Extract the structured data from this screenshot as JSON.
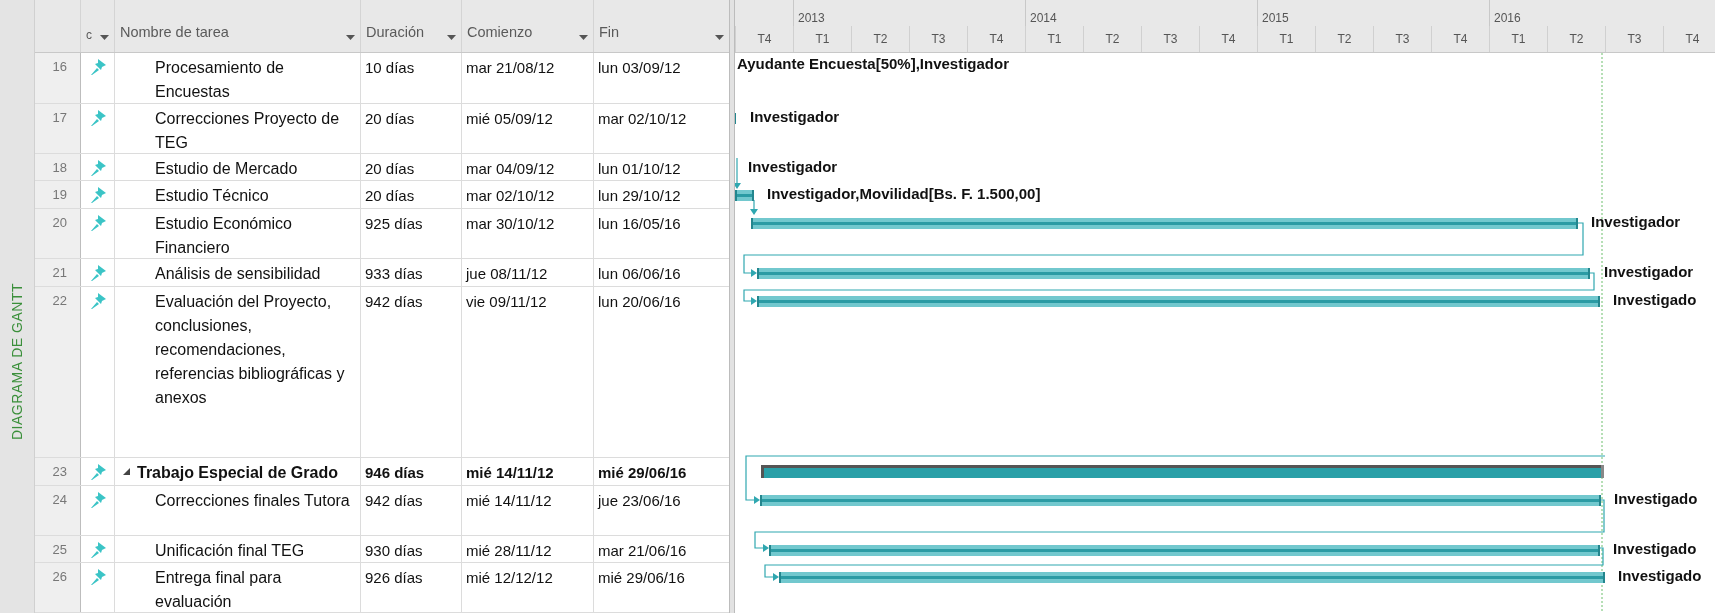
{
  "view_label": "DIAGRAMA DE GANTT",
  "columns": [
    {
      "label": "c",
      "kind": "indicator"
    },
    {
      "label": "Nombre de tarea",
      "kind": "name"
    },
    {
      "label": "Duración",
      "kind": "duration"
    },
    {
      "label": "Comienzo",
      "kind": "start"
    },
    {
      "label": "Fin",
      "kind": "finish"
    }
  ],
  "timescale": {
    "years": [
      {
        "label": "2013"
      },
      {
        "label": "2014"
      },
      {
        "label": "2015"
      },
      {
        "label": "2016"
      }
    ],
    "quarters": [
      {
        "label": "T4"
      },
      {
        "label": "T1"
      },
      {
        "label": "T2"
      },
      {
        "label": "T3"
      },
      {
        "label": "T4"
      },
      {
        "label": "T1"
      },
      {
        "label": "T2"
      },
      {
        "label": "T3"
      },
      {
        "label": "T4"
      },
      {
        "label": "T1"
      },
      {
        "label": "T2"
      },
      {
        "label": "T3"
      },
      {
        "label": "T4"
      },
      {
        "label": "T1"
      },
      {
        "label": "T2"
      },
      {
        "label": "T3"
      },
      {
        "label": "T4"
      }
    ]
  },
  "tasks": [
    {
      "id": "16",
      "kind": "task",
      "pinned": true,
      "name": "Procesamiento de Encuestas",
      "duration": "10 días",
      "start": "mar 21/08/12",
      "finish": "lun 03/09/12",
      "bar_label": "Ayudante Encuesta[50%],Investigador"
    },
    {
      "id": "17",
      "kind": "task",
      "pinned": true,
      "name": "Correcciones Proyecto de TEG",
      "duration": "20 días",
      "start": "mié 05/09/12",
      "finish": "mar 02/10/12",
      "bar_label": "Investigador"
    },
    {
      "id": "18",
      "kind": "task",
      "pinned": true,
      "name": "Estudio de Mercado",
      "duration": "20 días",
      "start": "mar 04/09/12",
      "finish": "lun 01/10/12",
      "bar_label": "Investigador"
    },
    {
      "id": "19",
      "kind": "task",
      "pinned": true,
      "name": "Estudio Técnico",
      "duration": "20 días",
      "start": "mar 02/10/12",
      "finish": "lun 29/10/12",
      "bar_label": "Investigador,Movilidad[Bs. F. 1.500,00]"
    },
    {
      "id": "20",
      "kind": "task",
      "pinned": true,
      "name": "Estudio Económico Financiero",
      "duration": "925 días",
      "start": "mar 30/10/12",
      "finish": "lun 16/05/16",
      "bar_label": "Investigador"
    },
    {
      "id": "21",
      "kind": "task",
      "pinned": true,
      "name": "Análisis de sensibilidad",
      "duration": "933 días",
      "start": "jue 08/11/12",
      "finish": "lun 06/06/16",
      "bar_label": "Investigador"
    },
    {
      "id": "22",
      "kind": "task",
      "pinned": true,
      "name": "Evaluación del Proyecto, conclusiones, recomendaciones, referencias bibliográficas y anexos",
      "duration": "942 días",
      "start": "vie 09/11/12",
      "finish": "lun 20/06/16",
      "bar_label": "Investigado"
    },
    {
      "id": "23",
      "kind": "summary",
      "pinned": true,
      "expanded": true,
      "name": "Trabajo Especial de Grado",
      "duration": "946 días",
      "start": "mié 14/11/12",
      "finish": "mié 29/06/16",
      "children": [
        {
          "id": "24",
          "kind": "task",
          "pinned": true,
          "name": "Correcciones finales Tutora",
          "duration": "942 días",
          "start": "mié 14/11/12",
          "finish": "jue 23/06/16",
          "bar_label": "Investigado"
        },
        {
          "id": "25",
          "kind": "task",
          "pinned": true,
          "name": "Unificación final TEG",
          "duration": "930 días",
          "start": "mié 28/11/12",
          "finish": "mar 21/06/16",
          "bar_label": "Investigado"
        },
        {
          "id": "26",
          "kind": "task",
          "pinned": true,
          "name": "Entrega final para evaluación",
          "duration": "926 días",
          "start": "mié 12/12/12",
          "finish": "mié 29/06/16",
          "bar_label": "Investigado"
        }
      ]
    }
  ]
}
